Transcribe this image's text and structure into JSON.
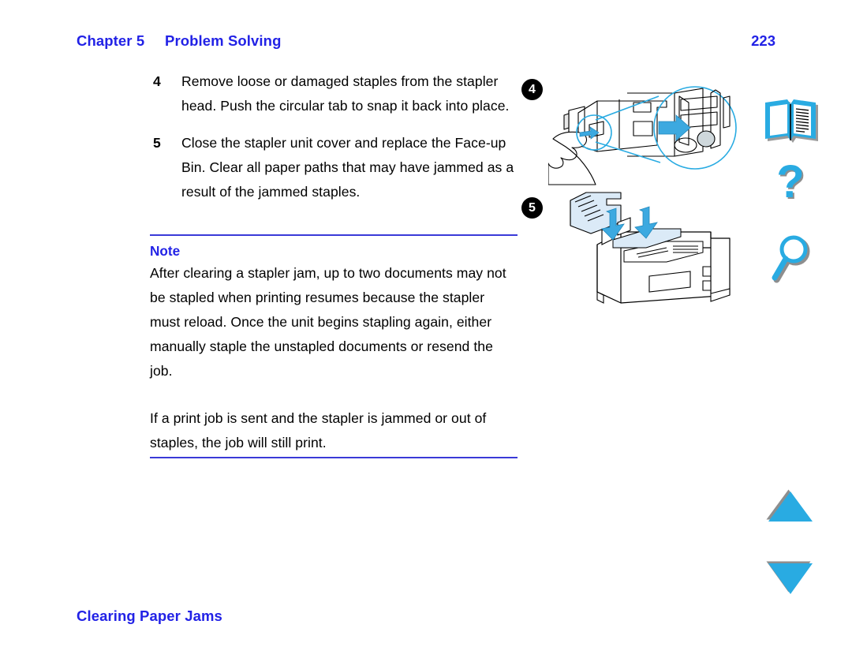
{
  "header": {
    "chapter_label": "Chapter 5",
    "chapter_title": "Problem Solving",
    "page_number": "223"
  },
  "steps": [
    {
      "number": "4",
      "text": "Remove loose or damaged staples from the stapler head. Push the circular tab to snap it back into place."
    },
    {
      "number": "5",
      "text": "Close the stapler unit cover and replace the Face-up Bin. Clear all paper paths that may have jammed as a result of the jammed staples."
    }
  ],
  "note": {
    "heading": "Note",
    "paragraph_1": "After clearing a stapler jam, up to two documents may not be stapled when printing resumes because the stapler must reload. Once the unit begins stapling again, either manually staple the unstapled documents or resend the job.",
    "paragraph_2": "If a print job is sent and the stapler is jammed or out of staples, the job will still print."
  },
  "footer": {
    "section_label": "Clearing Paper Jams"
  },
  "figures": [
    {
      "marker": "4",
      "caption_ref": "stapler head circular tab detail"
    },
    {
      "marker": "5",
      "caption_ref": "replace Face-up Bin on printer"
    }
  ],
  "nav_rail": [
    {
      "icon": "open-book-icon",
      "label": "Contents"
    },
    {
      "icon": "question-mark-icon",
      "label": "Help"
    },
    {
      "icon": "magnifying-glass-icon",
      "label": "Search"
    },
    {
      "icon": "triangle-up-icon",
      "label": "Previous Page"
    },
    {
      "icon": "triangle-down-icon",
      "label": "Next Page"
    }
  ],
  "colors": {
    "heading_blue": "#2222e6",
    "rule_blue": "#3a3ad8",
    "icon_cyan": "#29abe2",
    "icon_shadow": "#808080",
    "marker_black": "#000000"
  }
}
